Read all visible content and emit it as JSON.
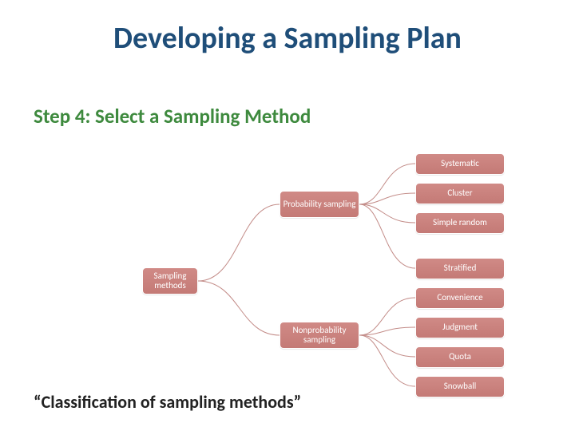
{
  "title": "Developing a Sampling Plan",
  "subtitle": "Step 4: Select a Sampling Method",
  "caption": "“Classification of sampling methods”",
  "nodes": {
    "root": "Sampling methods",
    "prob": "Probability sampling",
    "nonprob": "Nonprobability sampling",
    "systematic": "Systematic",
    "cluster": "Cluster",
    "simple_random": "Simple random",
    "stratified": "Stratified",
    "convenience": "Convenience",
    "judgment": "Judgment",
    "quota": "Quota",
    "snowball": "Snowball"
  }
}
